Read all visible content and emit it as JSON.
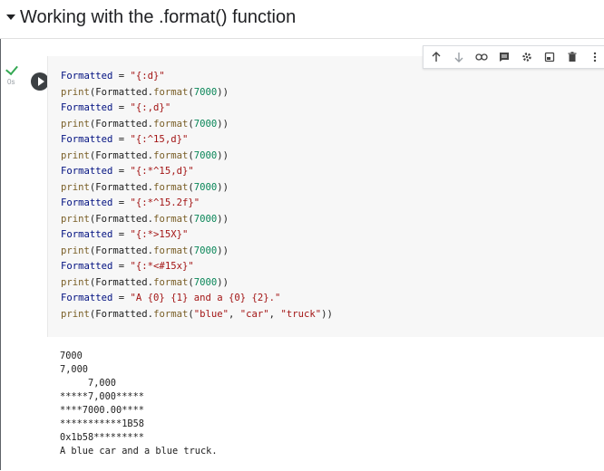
{
  "section": {
    "title": "Working with the .format() function"
  },
  "cell": {
    "exec_time": "0s",
    "code_lines": [
      [
        {
          "t": "id",
          "v": "Formatted"
        },
        {
          "t": "plain",
          "v": " = "
        },
        {
          "t": "str",
          "v": "\"{:d}\""
        }
      ],
      [
        {
          "t": "fn",
          "v": "print"
        },
        {
          "t": "plain",
          "v": "(Formatted."
        },
        {
          "t": "fn",
          "v": "format"
        },
        {
          "t": "plain",
          "v": "("
        },
        {
          "t": "num",
          "v": "7000"
        },
        {
          "t": "plain",
          "v": "))"
        }
      ],
      [
        {
          "t": "id",
          "v": "Formatted"
        },
        {
          "t": "plain",
          "v": " = "
        },
        {
          "t": "str",
          "v": "\"{:,d}\""
        }
      ],
      [
        {
          "t": "fn",
          "v": "print"
        },
        {
          "t": "plain",
          "v": "(Formatted."
        },
        {
          "t": "fn",
          "v": "format"
        },
        {
          "t": "plain",
          "v": "("
        },
        {
          "t": "num",
          "v": "7000"
        },
        {
          "t": "plain",
          "v": "))"
        }
      ],
      [
        {
          "t": "id",
          "v": "Formatted"
        },
        {
          "t": "plain",
          "v": " = "
        },
        {
          "t": "str",
          "v": "\"{:^15,d}\""
        }
      ],
      [
        {
          "t": "fn",
          "v": "print"
        },
        {
          "t": "plain",
          "v": "(Formatted."
        },
        {
          "t": "fn",
          "v": "format"
        },
        {
          "t": "plain",
          "v": "("
        },
        {
          "t": "num",
          "v": "7000"
        },
        {
          "t": "plain",
          "v": "))"
        }
      ],
      [
        {
          "t": "id",
          "v": "Formatted"
        },
        {
          "t": "plain",
          "v": " = "
        },
        {
          "t": "str",
          "v": "\"{:*^15,d}\""
        }
      ],
      [
        {
          "t": "fn",
          "v": "print"
        },
        {
          "t": "plain",
          "v": "(Formatted."
        },
        {
          "t": "fn",
          "v": "format"
        },
        {
          "t": "plain",
          "v": "("
        },
        {
          "t": "num",
          "v": "7000"
        },
        {
          "t": "plain",
          "v": "))"
        }
      ],
      [
        {
          "t": "id",
          "v": "Formatted"
        },
        {
          "t": "plain",
          "v": " = "
        },
        {
          "t": "str",
          "v": "\"{:*^15.2f}\""
        }
      ],
      [
        {
          "t": "fn",
          "v": "print"
        },
        {
          "t": "plain",
          "v": "(Formatted."
        },
        {
          "t": "fn",
          "v": "format"
        },
        {
          "t": "plain",
          "v": "("
        },
        {
          "t": "num",
          "v": "7000"
        },
        {
          "t": "plain",
          "v": "))"
        }
      ],
      [
        {
          "t": "id",
          "v": "Formatted"
        },
        {
          "t": "plain",
          "v": " = "
        },
        {
          "t": "str",
          "v": "\"{:*>15X}\""
        }
      ],
      [
        {
          "t": "fn",
          "v": "print"
        },
        {
          "t": "plain",
          "v": "(Formatted."
        },
        {
          "t": "fn",
          "v": "format"
        },
        {
          "t": "plain",
          "v": "("
        },
        {
          "t": "num",
          "v": "7000"
        },
        {
          "t": "plain",
          "v": "))"
        }
      ],
      [
        {
          "t": "id",
          "v": "Formatted"
        },
        {
          "t": "plain",
          "v": " = "
        },
        {
          "t": "str",
          "v": "\"{:*<#15x}\""
        }
      ],
      [
        {
          "t": "fn",
          "v": "print"
        },
        {
          "t": "plain",
          "v": "(Formatted."
        },
        {
          "t": "fn",
          "v": "format"
        },
        {
          "t": "plain",
          "v": "("
        },
        {
          "t": "num",
          "v": "7000"
        },
        {
          "t": "plain",
          "v": "))"
        }
      ],
      [
        {
          "t": "id",
          "v": "Formatted"
        },
        {
          "t": "plain",
          "v": " = "
        },
        {
          "t": "str",
          "v": "\"A {0} {1} and a {0} {2}.\""
        }
      ],
      [
        {
          "t": "fn",
          "v": "print"
        },
        {
          "t": "plain",
          "v": "(Formatted."
        },
        {
          "t": "fn",
          "v": "format"
        },
        {
          "t": "plain",
          "v": "("
        },
        {
          "t": "str",
          "v": "\"blue\""
        },
        {
          "t": "plain",
          "v": ", "
        },
        {
          "t": "str",
          "v": "\"car\""
        },
        {
          "t": "plain",
          "v": ", "
        },
        {
          "t": "str",
          "v": "\"truck\""
        },
        {
          "t": "plain",
          "v": "))"
        }
      ]
    ]
  },
  "toolbar": {
    "icons": [
      "arrow-up-icon",
      "arrow-down-icon",
      "link-icon",
      "comment-icon",
      "gear-icon",
      "mirror-cell-icon",
      "trash-icon",
      "more-vert-icon"
    ]
  },
  "output": {
    "lines": [
      "7000",
      "7,000",
      "     7,000",
      "*****7,000*****",
      "****7000.00****",
      "***********1B58",
      "0x1b58*********",
      "A blue car and a blue truck."
    ]
  }
}
